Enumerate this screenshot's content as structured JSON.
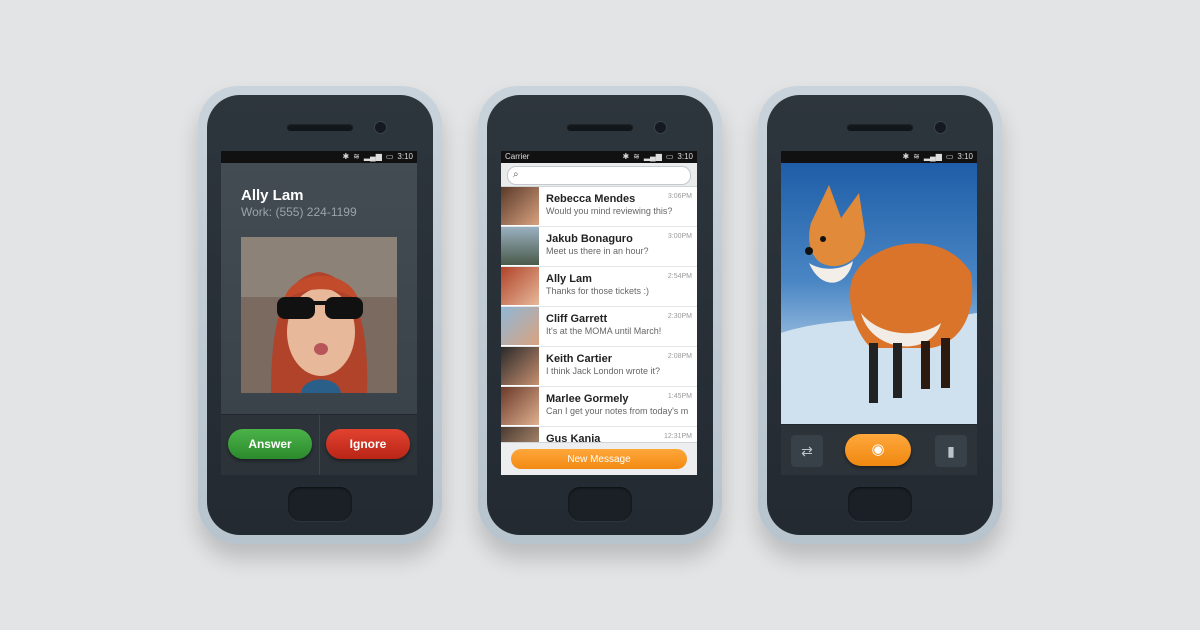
{
  "status_bar": {
    "time": "3:10",
    "carrier": "Carrier"
  },
  "call": {
    "caller_name": "Ally Lam",
    "caller_detail": "Work: (555) 224-1199",
    "answer_label": "Answer",
    "ignore_label": "Ignore"
  },
  "messages": {
    "items": [
      {
        "name": "Rebecca Mendes",
        "preview": "Would you mind reviewing this?",
        "time": "3:06PM"
      },
      {
        "name": "Jakub Bonaguro",
        "preview": "Meet us there in an hour?",
        "time": "3:00PM"
      },
      {
        "name": "Ally Lam",
        "preview": "Thanks for those tickets :)",
        "time": "2:54PM"
      },
      {
        "name": "Cliff Garrett",
        "preview": "It's at the MOMA until March!",
        "time": "2:30PM"
      },
      {
        "name": "Keith Cartier",
        "preview": "I think Jack London wrote it?",
        "time": "2:08PM"
      },
      {
        "name": "Marlee Gormely",
        "preview": "Can I get your notes from today's m",
        "time": "1:45PM"
      },
      {
        "name": "Gus Kania",
        "preview": "",
        "time": "12:31PM"
      }
    ],
    "new_message_label": "New Message"
  },
  "camera": {
    "switch_icon": "switch-camera-icon",
    "shutter_icon": "camera-icon",
    "mode_icon": "video-mode-icon"
  }
}
